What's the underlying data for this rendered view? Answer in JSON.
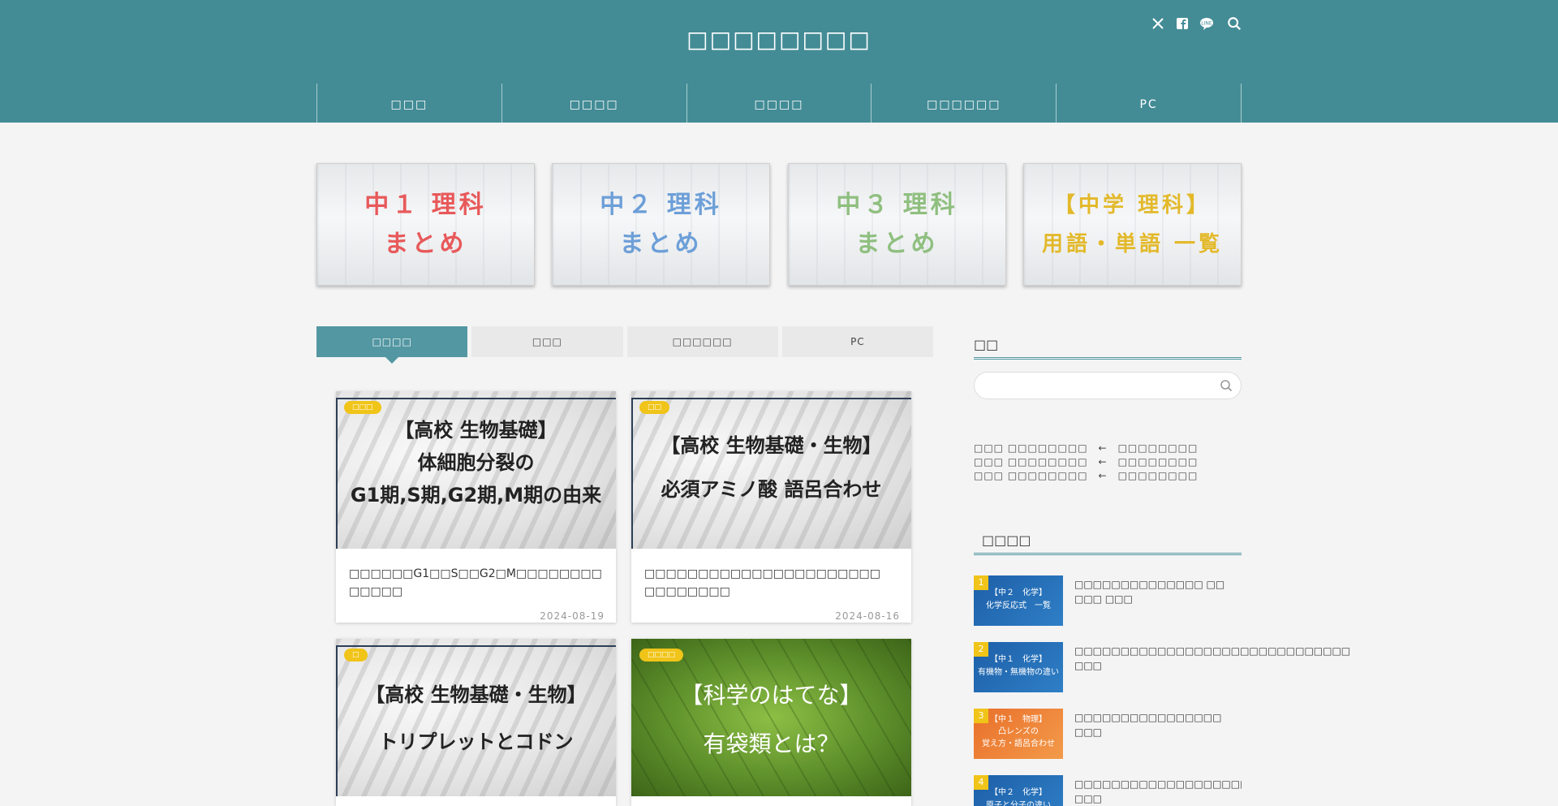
{
  "header": {
    "site_title": "□□□□□□□□",
    "icons": [
      "x-icon",
      "facebook-icon",
      "line-icon",
      "search-icon"
    ]
  },
  "nav": {
    "items": [
      "□□□",
      "□□□□",
      "□□□□",
      "□□□□□□",
      "PC"
    ]
  },
  "banners": [
    {
      "line1": "中１ 理科",
      "line2": "まとめ",
      "color": "#e8595a"
    },
    {
      "line1": "中２ 理科",
      "line2": "まとめ",
      "color": "#6d9fd8"
    },
    {
      "line1": "中３ 理科",
      "line2": "まとめ",
      "color": "#8fbf7f"
    },
    {
      "line1": "【中学 理科】",
      "line2": "用語・単語 一覧",
      "color": "#e3b92a"
    }
  ],
  "tabs": [
    "□□□□",
    "□□□",
    "□□□□□□",
    "PC"
  ],
  "cards": [
    {
      "badge": "□□□",
      "thumb_lines": [
        "【高校 生物基礎】",
        "体細胞分裂の",
        "G1期,S期,G2期,M期の由来"
      ],
      "title": "□□□□□□G1□□S□□G2□M□□□□□□□□ □□□□□",
      "date": "2024-08-19"
    },
    {
      "badge": "□□",
      "thumb_lines": [
        "【高校 生物基礎・生物】",
        "必須アミノ酸 語呂合わせ"
      ],
      "title": "□□□□□□□□□□□□□□□□□□□□□□ □□□□□□□□",
      "date": "2024-08-16"
    },
    {
      "badge": "□",
      "thumb_lines": [
        "【高校 生物基礎・生物】",
        "トリプレットとコドン"
      ],
      "title": "",
      "date": ""
    },
    {
      "badge": "□□□□",
      "thumb_lines": [
        "【科学のはてな】",
        "有袋類とは？"
      ],
      "title": "",
      "date": ""
    }
  ],
  "sidebar": {
    "search_heading": "□□",
    "recent_lines": [
      "□□□ □□□□□□□□　←　□□□□□□□□",
      "□□□ □□□□□□□□　←　□□□□□□□□",
      "□□□ □□□□□□□□　←　□□□□□□□□"
    ],
    "ranking_heading": "□□□□",
    "ranking": [
      {
        "num": "1",
        "thumb_lines": [
          "【中２　化学】",
          "化学反応式　一覧"
        ],
        "title": "□□□□□□□□□□□□□□ □□ □□□ □□□"
      },
      {
        "num": "2",
        "thumb_lines": [
          "【中１　化学】",
          "有機物・無機物の違い"
        ],
        "title": "□□□□□□□□□□□□□□□□□□□□□□□□□□□□□□ □□□"
      },
      {
        "num": "3",
        "thumb_lines": [
          "【中１　物理】",
          "凸レンズの",
          "覚え方・語呂合わせ"
        ],
        "title": "□□□□□□□□□□□□□□□□ □□□"
      },
      {
        "num": "4",
        "thumb_lines": [
          "【中２　化学】",
          "原子と分子の違い"
        ],
        "title": "□□□□□□□□□□□□□□□□□□□□□□□□ □□□"
      }
    ]
  }
}
